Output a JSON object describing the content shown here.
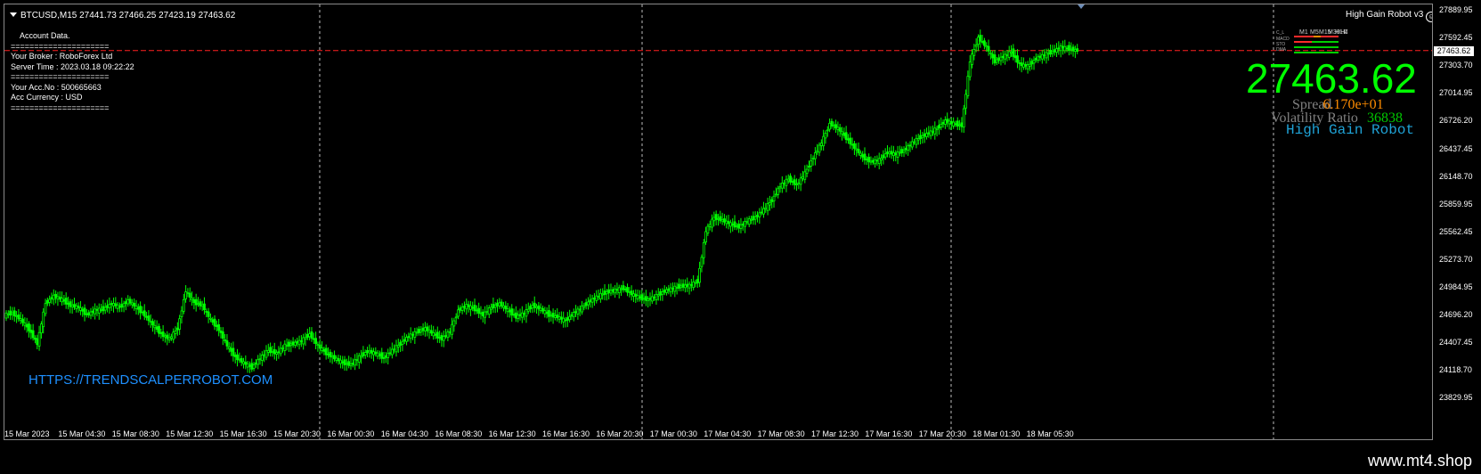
{
  "header": {
    "symbol_line": "BTCUSD,M15  27441.73 27466.25 27423.19 27463.62",
    "robot_title": "High Gain Robot v3",
    "smiley": "☺"
  },
  "account": {
    "lines": [
      "Account Data.",
      "=====================",
      "Your Broker  : RoboForex Ltd",
      "Server Time : 2023.03.18 09:22:22",
      "=====================",
      "Your Acc.No  : 500665663",
      "Acc Currency : USD",
      "====================="
    ]
  },
  "timeframes": {
    "labels": [
      "M1",
      "M5",
      "M15",
      "M30",
      "H1",
      "H4",
      "D1"
    ],
    "rows": [
      "C_L",
      "MACD",
      "STO",
      "DMA"
    ]
  },
  "price_display": {
    "price": "27463.62",
    "spread_label": "Spread",
    "spread_value": "6.170e+01",
    "volatility_label": "Volatility Ratio",
    "volatility_value": "36838",
    "robot_name": "High Gain Robot"
  },
  "watermark_link": "HTTPS://TRENDSCALPERROBOT.COM",
  "price_axis": {
    "labels": [
      "27889.95",
      "27592.45",
      "27303.70",
      "27014.95",
      "26726.20",
      "26437.45",
      "26148.70",
      "25859.95",
      "25562.45",
      "25273.70",
      "24984.95",
      "24696.20",
      "24407.45",
      "24118.70",
      "23829.95"
    ],
    "current_tag": "27463.62"
  },
  "time_axis": {
    "labels": [
      "15 Mar 2023",
      "15 Mar 04:30",
      "15 Mar 08:30",
      "15 Mar 12:30",
      "15 Mar 16:30",
      "15 Mar 20:30",
      "16 Mar 00:30",
      "16 Mar 04:30",
      "16 Mar 08:30",
      "16 Mar 12:30",
      "16 Mar 16:30",
      "16 Mar 20:30",
      "17 Mar 00:30",
      "17 Mar 04:30",
      "17 Mar 08:30",
      "17 Mar 12:30",
      "17 Mar 16:30",
      "17 Mar 20:30",
      "18 Mar 01:30",
      "18 Mar 05:30"
    ]
  },
  "chart_data": {
    "type": "line",
    "title": "BTCUSD,M15",
    "ylim": [
      23829.95,
      27889.95
    ],
    "current_price": 27463.62,
    "series": [
      {
        "name": "BTCUSD",
        "y": [
          24700,
          24720,
          24650,
          24550,
          24400,
          24820,
          24900,
          24860,
          24800,
          24780,
          24700,
          24750,
          24760,
          24820,
          24780,
          24850,
          24780,
          24700,
          24600,
          24500,
          24450,
          24560,
          24950,
          24830,
          24800,
          24650,
          24550,
          24380,
          24260,
          24200,
          24150,
          24250,
          24330,
          24300,
          24380,
          24400,
          24430,
          24500,
          24380,
          24300,
          24250,
          24200,
          24180,
          24260,
          24320,
          24300,
          24250,
          24330,
          24400,
          24480,
          24520,
          24560,
          24500,
          24450,
          24530,
          24750,
          24800,
          24760,
          24700,
          24780,
          24820,
          24750,
          24680,
          24720,
          24800,
          24760,
          24700,
          24680,
          24640,
          24720,
          24780,
          24850,
          24900,
          24940,
          24960,
          24980,
          24920,
          24880,
          24860,
          24900,
          24950,
          24980,
          25000,
          25010,
          25050,
          25580,
          25720,
          25690,
          25650,
          25620,
          25680,
          25720,
          25800,
          25900,
          26050,
          26120,
          26060,
          26180,
          26350,
          26500,
          26700,
          26650,
          26550,
          26450,
          26350,
          26300,
          26320,
          26400,
          26380,
          26420,
          26500,
          26560,
          26600,
          26650,
          26730,
          26700,
          26680,
          27350,
          27600,
          27500,
          27350,
          27400,
          27450,
          27320,
          27300,
          27380,
          27420,
          27450,
          27500,
          27480,
          27463.62
        ]
      }
    ]
  }
}
